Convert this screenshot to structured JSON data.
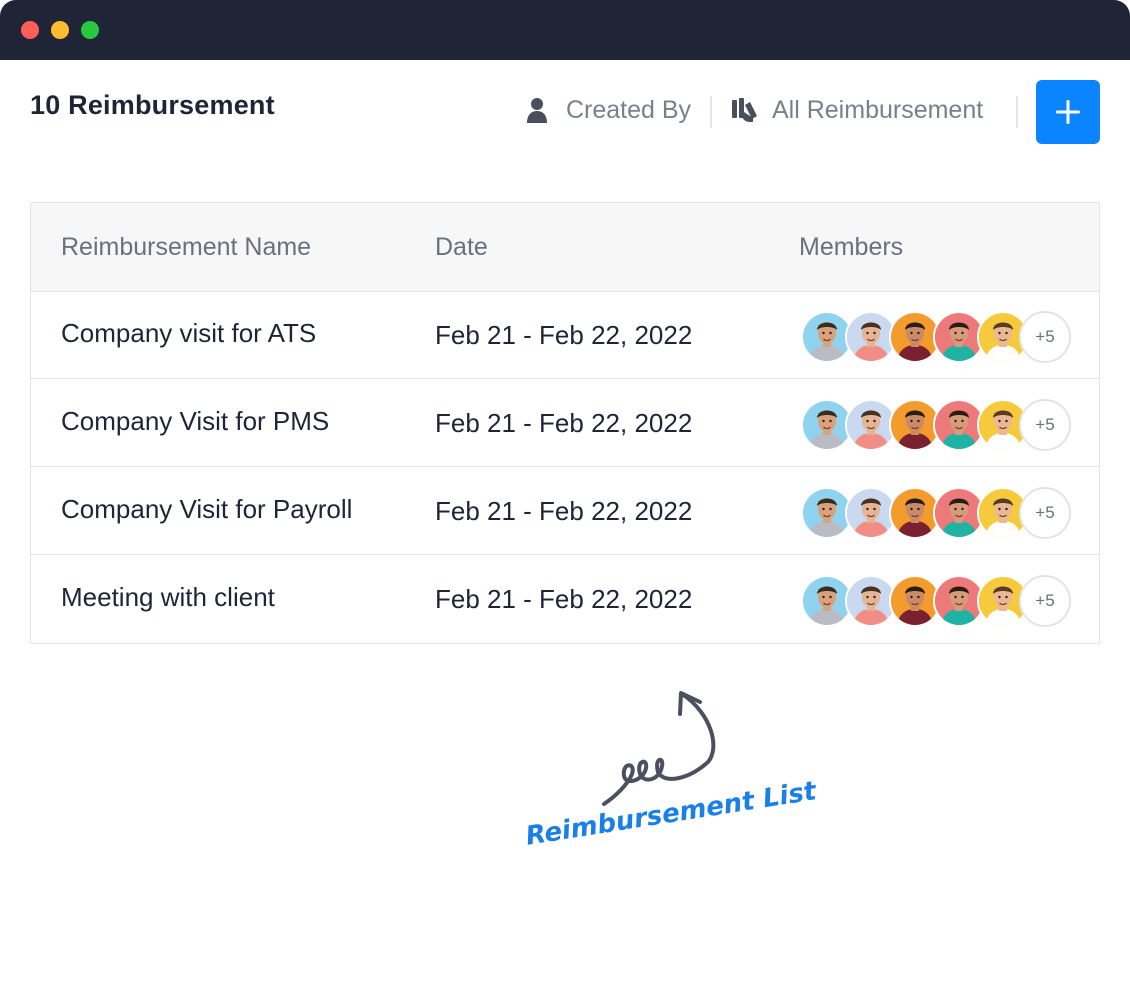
{
  "window": {
    "controls": [
      {
        "name": "close",
        "color": "#ff5f57"
      },
      {
        "name": "minimize",
        "color": "#febc2e"
      },
      {
        "name": "zoom",
        "color": "#28c840"
      }
    ]
  },
  "header": {
    "title": "10 Reimbursement",
    "filters": {
      "created_by": {
        "label": "Created By",
        "icon": "user-icon"
      },
      "all_reimbursement": {
        "label": "All Reimbursement",
        "icon": "documents-icon"
      }
    },
    "add_button": {
      "icon": "plus-icon",
      "color": "#0a84ff"
    }
  },
  "table": {
    "columns": [
      "Reimbursement Name",
      "Date",
      "Members"
    ],
    "rows": [
      {
        "name": "Company visit for ATS",
        "date": "Feb 21 - Feb 22, 2022",
        "more_members": "+5"
      },
      {
        "name": "Company Visit for PMS",
        "date": "Feb 21 - Feb 22, 2022",
        "more_members": "+5"
      },
      {
        "name": "Company Visit for Payroll",
        "date": "Feb 21 - Feb 22, 2022",
        "more_members": "+5"
      },
      {
        "name": "Meeting with client",
        "date": "Feb 21 - Feb 22, 2022",
        "more_members": "+5"
      }
    ],
    "member_avatars": [
      {
        "background": "#8fd3ee",
        "skin": "#d9a27c",
        "hair": "#3b2a20",
        "shirt": "#b9bcc4"
      },
      {
        "background": "#c9d9f0",
        "skin": "#e3b594",
        "hair": "#4a3022",
        "shirt": "#f08e86"
      },
      {
        "background": "#f39b2d",
        "skin": "#c98b66",
        "hair": "#2c1d16",
        "shirt": "#7b2030"
      },
      {
        "background": "#ec7a7a",
        "skin": "#d69b78",
        "hair": "#2b1b15",
        "shirt": "#1fb3a3"
      },
      {
        "background": "#f7ca3b",
        "skin": "#e9b996",
        "hair": "#5a3a22",
        "shirt": "#ffffff"
      }
    ]
  },
  "annotation": {
    "label": "Reimbursement List",
    "color": "#1a7fe6",
    "arrow_color": "#4b5060",
    "arrow_icon": "curly-arrow-icon"
  },
  "theme": {
    "titlebar": "#1f2437",
    "text_primary": "#1f2437",
    "text_muted": "#6b7080",
    "border": "#e2e4e8"
  }
}
